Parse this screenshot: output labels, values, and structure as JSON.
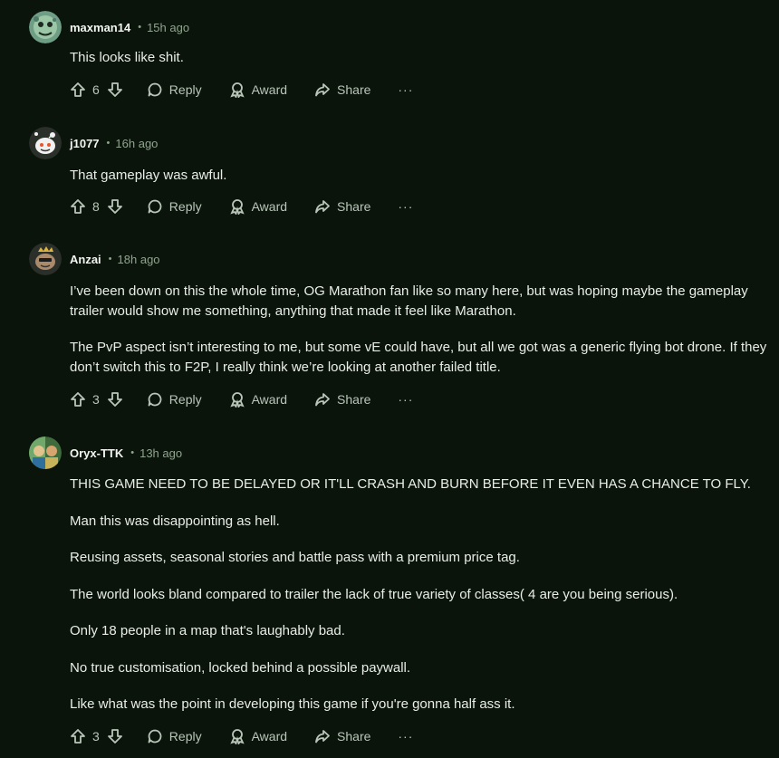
{
  "comments": [
    {
      "username": "maxman14",
      "time": "15h ago",
      "paragraphs": [
        "This looks like shit."
      ],
      "votes": "6",
      "avatar_color": "#8fbf9a"
    },
    {
      "username": "j1077",
      "time": "16h ago",
      "paragraphs": [
        "That gameplay was awful."
      ],
      "votes": "8",
      "avatar_color": "#e9e9e9"
    },
    {
      "username": "Anzai",
      "time": "18h ago",
      "paragraphs": [
        "I’ve been down on this the whole time, OG Marathon fan like so many here, but was hoping maybe the gameplay trailer would show me something, anything that made it feel like Marathon.",
        "The PvP aspect isn’t interesting to me, but some vE could have, but all we got was a generic flying bot drone. If they don’t switch this to F2P, I really think we’re looking at another failed title."
      ],
      "votes": "3",
      "avatar_color": "#c9b27a"
    },
    {
      "username": "Oryx-TTK",
      "time": "13h ago",
      "paragraphs": [
        "THIS GAME NEED TO BE DELAYED OR IT'LL CRASH AND BURN BEFORE IT EVEN HAS A CHANCE TO FLY.",
        "Man this was disappointing as hell.",
        "Reusing assets, seasonal stories and battle pass with a premium price tag.",
        "The world looks bland compared to trailer the lack of true variety of classes( 4 are you being serious).",
        "Only 18 people in a map that's laughably bad.",
        "No true customisation, locked behind a possible paywall.",
        "Like what was the point in developing this game if you're gonna half ass it."
      ],
      "votes": "3",
      "avatar_color": "#6fa86a"
    }
  ],
  "actions": {
    "reply": "Reply",
    "award": "Award",
    "share": "Share",
    "more": "···"
  },
  "icons": [
    "upvote-icon",
    "downvote-icon",
    "reply-icon",
    "award-icon",
    "share-icon",
    "more-icon"
  ],
  "colors": {
    "background": "#0b140b",
    "meta": "#8fa48f",
    "action": "#b9c6b9"
  }
}
